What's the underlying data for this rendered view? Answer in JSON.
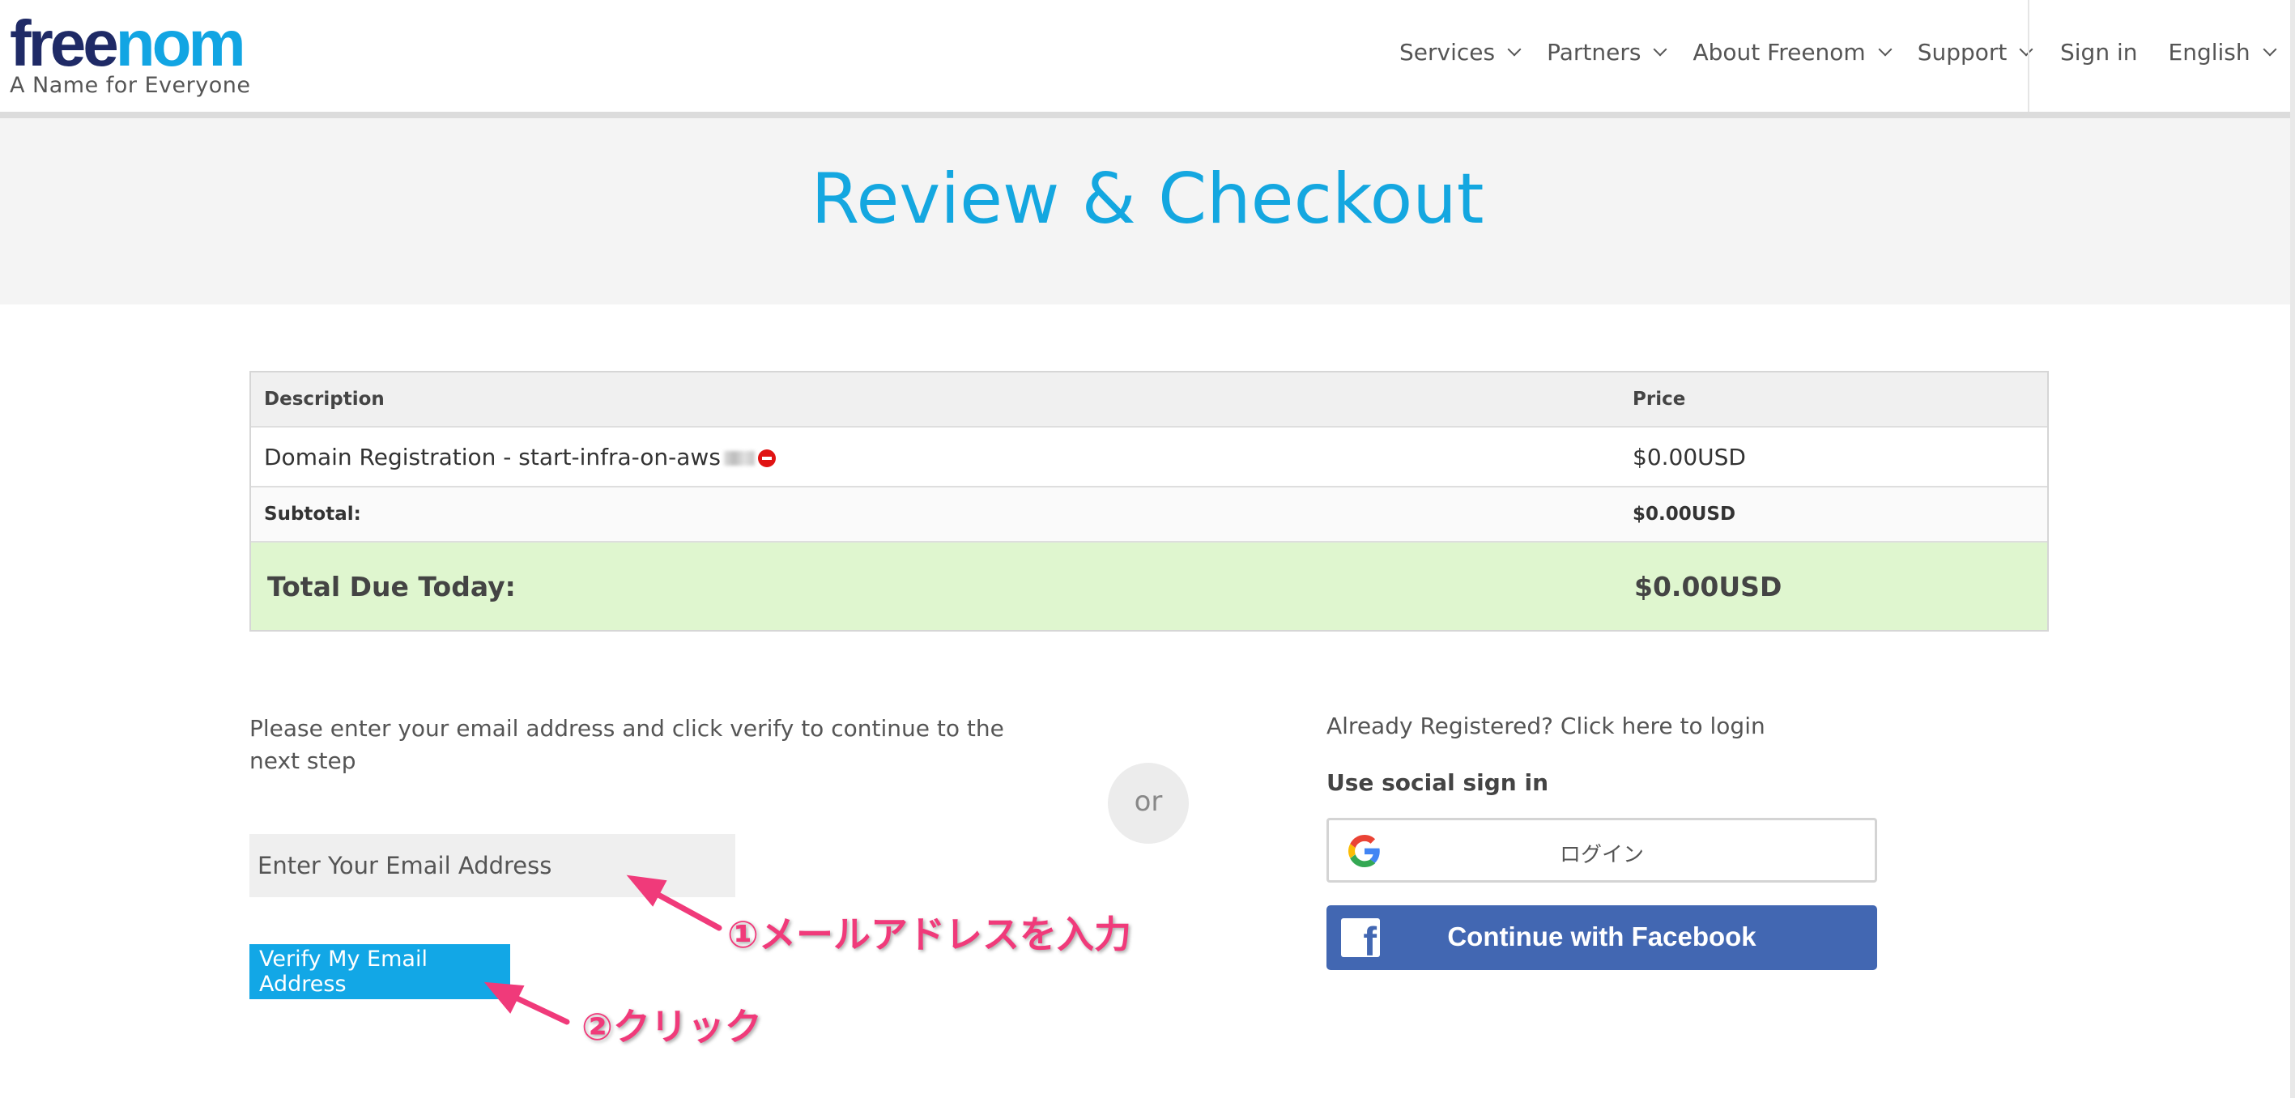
{
  "header": {
    "logo": {
      "part1": "free",
      "part2": "nom",
      "tagline": "A Name for Everyone"
    },
    "nav": [
      {
        "label": "Services"
      },
      {
        "label": "Partners"
      },
      {
        "label": "About Freenom"
      },
      {
        "label": "Support"
      }
    ],
    "sign_in": "Sign in",
    "language": "English"
  },
  "banner": {
    "title": "Review & Checkout"
  },
  "cart": {
    "headers": {
      "description": "Description",
      "price": "Price"
    },
    "item": {
      "description": "Domain Registration - start-infra-on-aws",
      "price": "$0.00USD"
    },
    "subtotal": {
      "label": "Subtotal:",
      "value": "$0.00USD"
    },
    "total": {
      "label": "Total Due Today:",
      "value": "$0.00USD"
    }
  },
  "email_form": {
    "intro": "Please enter your email address and click verify to continue to the next step",
    "placeholder": "Enter Your Email Address",
    "verify_label": "Verify My Email Address"
  },
  "divider": "or",
  "login": {
    "already_registered": "Already Registered? Click here to login",
    "social_title": "Use social sign in",
    "google_label": "ログイン",
    "facebook_label": "Continue with Facebook"
  },
  "annotations": {
    "step1": "①メールアドレスを入力",
    "step2": "②クリック",
    "color": "#f03a7a"
  },
  "colors": {
    "accent": "#14a7e0",
    "total_bg": "#dff6cf",
    "facebook": "#4267b2",
    "remove": "#e01313"
  }
}
